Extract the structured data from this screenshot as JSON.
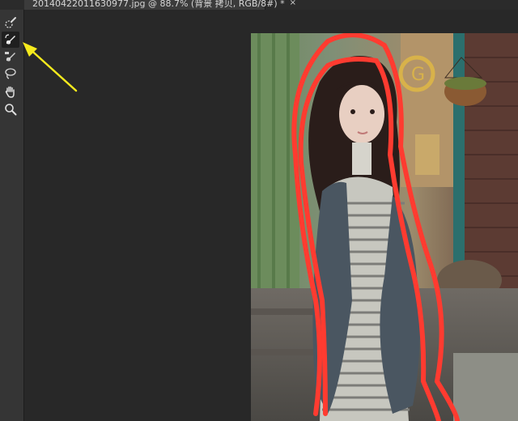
{
  "document_tab": {
    "title": "20140422011630977.jpg @ 88.7% (背景 拷贝, RGB/8#) *",
    "close_glyph": "×"
  },
  "toolbar": {
    "tools": [
      {
        "name": "quick-selection-icon",
        "active": false
      },
      {
        "name": "refine-radius-brush-icon",
        "active": true
      },
      {
        "name": "erase-refinements-brush-icon",
        "active": false
      },
      {
        "name": "lasso-icon",
        "active": false
      },
      {
        "name": "hand-icon",
        "active": false
      },
      {
        "name": "zoom-icon",
        "active": false
      }
    ]
  },
  "annotation": {
    "color": "#f5ea1d"
  },
  "selection_outline": {
    "color": "#ff3b30"
  }
}
